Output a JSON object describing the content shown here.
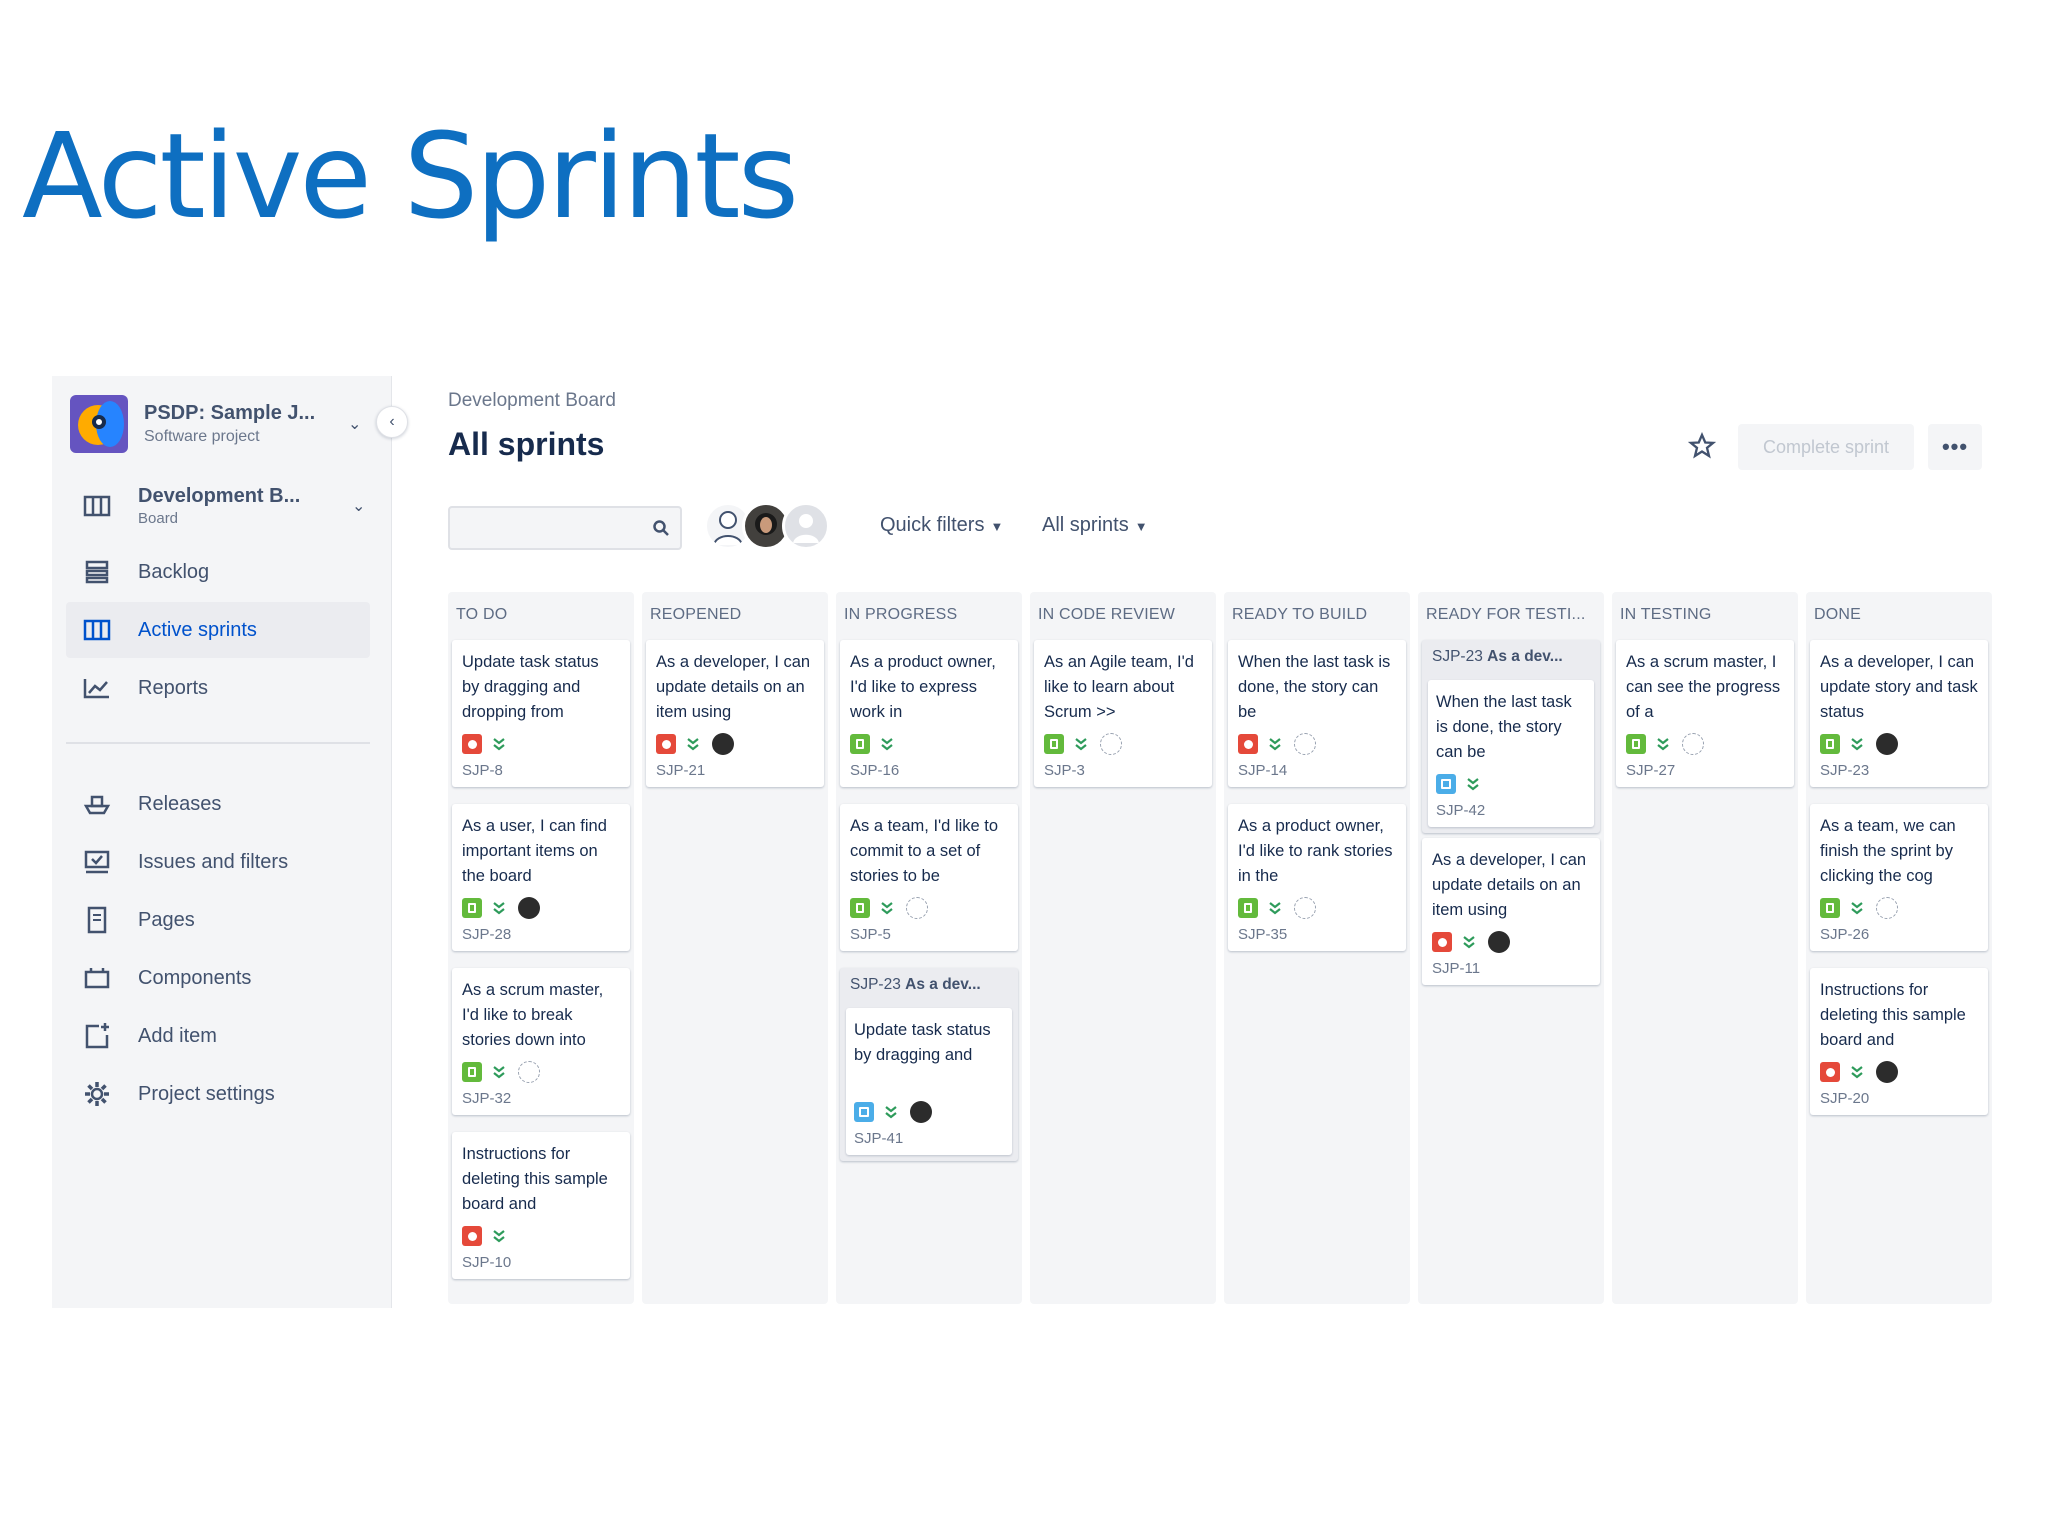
{
  "slide": {
    "title": "Active Sprints"
  },
  "sidebar": {
    "project_name": "PSDP: Sample J...",
    "project_type": "Software project",
    "board_name": "Development B...",
    "board_sub": "Board",
    "items": [
      {
        "label": "Backlog",
        "icon": "backlog-icon"
      },
      {
        "label": "Active sprints",
        "icon": "board-icon",
        "active": true
      },
      {
        "label": "Reports",
        "icon": "reports-icon"
      },
      {
        "label": "Releases",
        "icon": "ship-icon"
      },
      {
        "label": "Issues and filters",
        "icon": "issues-icon"
      },
      {
        "label": "Pages",
        "icon": "page-icon"
      },
      {
        "label": "Components",
        "icon": "component-icon"
      },
      {
        "label": "Add item",
        "icon": "add-item-icon"
      },
      {
        "label": "Project settings",
        "icon": "gear-icon"
      }
    ]
  },
  "header": {
    "breadcrumb": "Development Board",
    "title": "All sprints",
    "complete_label": "Complete sprint",
    "more_label": "•••"
  },
  "toolbar": {
    "search_placeholder": "",
    "quick_filters": "Quick filters",
    "sprint_filter": "All sprints"
  },
  "colors": {
    "accent": "#0052cc",
    "bug": "#e5493a",
    "story": "#63ba3c",
    "task": "#4bade8"
  },
  "board": {
    "columns": [
      {
        "name": "TO DO",
        "cards": [
          {
            "summary": "Update task status by dragging and dropping from",
            "key": "SJP-8",
            "type": "bug",
            "assignee": "none"
          },
          {
            "summary": "As a user, I can find important items on the board",
            "key": "SJP-28",
            "type": "story",
            "assignee": "dark"
          },
          {
            "summary": "As a scrum master, I'd like to break stories down into",
            "key": "SJP-32",
            "type": "story",
            "assignee": "light"
          },
          {
            "summary": "Instructions for deleting this sample board and",
            "key": "SJP-10",
            "type": "bug",
            "assignee": "none"
          }
        ]
      },
      {
        "name": "REOPENED",
        "cards": [
          {
            "summary": "As a developer, I can update details on an item using",
            "key": "SJP-21",
            "type": "bug",
            "assignee": "dark"
          }
        ]
      },
      {
        "name": "IN PROGRESS",
        "cards": [
          {
            "summary": "As a product owner, I'd like to express work in",
            "key": "SJP-16",
            "type": "story",
            "assignee": "none"
          },
          {
            "summary": "As a team, I'd like to commit to a set of stories to be",
            "key": "SJP-5",
            "type": "story",
            "assignee": "light"
          }
        ],
        "parent": {
          "key": "SJP-23",
          "title": "As a dev...",
          "sub": {
            "summary": "Update task status by dragging and",
            "key": "SJP-41",
            "type": "task",
            "assignee": "dark"
          }
        }
      },
      {
        "name": "IN CODE REVIEW",
        "cards": [
          {
            "summary": "As an Agile team, I'd like to learn about Scrum >>",
            "key": "SJP-3",
            "type": "story",
            "assignee": "light"
          }
        ]
      },
      {
        "name": "READY TO BUILD",
        "cards": [
          {
            "summary": "When the last task is done, the story can be",
            "key": "SJP-14",
            "type": "bug",
            "assignee": "light"
          },
          {
            "summary": "As a product owner, I'd like to rank stories in the",
            "key": "SJP-35",
            "type": "story",
            "assignee": "light"
          }
        ]
      },
      {
        "name": "READY FOR TESTI...",
        "cards": [
          {
            "summary": "As a developer, I can update details on an item using",
            "key": "SJP-11",
            "type": "bug",
            "assignee": "dark"
          }
        ],
        "parent": {
          "key": "SJP-23",
          "title": "As a dev...",
          "sub": {
            "summary": "When the last task is done, the story can be",
            "key": "SJP-42",
            "type": "task",
            "assignee": "none"
          }
        }
      },
      {
        "name": "IN TESTING",
        "cards": [
          {
            "summary": "As a scrum master, I can see the progress of a",
            "key": "SJP-27",
            "type": "story",
            "assignee": "light"
          }
        ]
      },
      {
        "name": "DONE",
        "cards": [
          {
            "summary": "As a developer, I can update story and task status",
            "key": "SJP-23",
            "type": "story",
            "assignee": "dark"
          },
          {
            "summary": "As a team, we can finish the sprint by clicking the cog",
            "key": "SJP-26",
            "type": "story",
            "assignee": "light"
          },
          {
            "summary": "Instructions for deleting this sample board and",
            "key": "SJP-20",
            "type": "bug",
            "assignee": "dark"
          }
        ]
      }
    ]
  }
}
